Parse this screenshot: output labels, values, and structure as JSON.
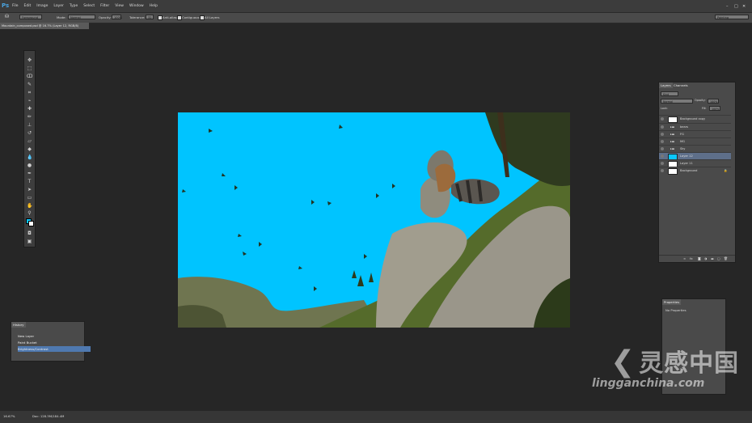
{
  "app": {
    "logo": "Ps"
  },
  "menu": [
    "File",
    "Edit",
    "Image",
    "Layer",
    "Type",
    "Select",
    "Filter",
    "View",
    "Window",
    "Help"
  ],
  "window_controls": [
    "–",
    "□",
    "✕"
  ],
  "options": {
    "sample": "Foreground",
    "mode_label": "Mode:",
    "mode_value": "Normal",
    "opacity_label": "Opacity:",
    "opacity_value": "100%",
    "tolerance_label": "Tolerance:",
    "tolerance_value": "32",
    "anti_alias": "Anti-alias",
    "contiguous": "Contiguous",
    "all_layers": "All Layers",
    "workspace": "Painting"
  },
  "document_tab": "Mountain_composed.psd @ 16.7% (Layer 12, RGB/8)",
  "layers_panel": {
    "tabs": [
      "Layers",
      "Channels"
    ],
    "kind": "Kind",
    "blend": "Normal",
    "opacity_label": "Opacity:",
    "opacity_value": "100%",
    "lock_label": "Lock:",
    "fill_label": "Fill:",
    "fill_value": "100%",
    "layers": [
      {
        "name": "Background copy"
      },
      {
        "name": "bears"
      },
      {
        "name": "FG"
      },
      {
        "name": "MG"
      },
      {
        "name": "Sky"
      },
      {
        "name": "Layer 12"
      },
      {
        "name": "Layer 11"
      },
      {
        "name": "Background"
      }
    ]
  },
  "history_panel": {
    "title": "History",
    "items": [
      "New Layer",
      "Paint Bucket",
      "Brightness/Contrast"
    ]
  },
  "properties_panel": {
    "title": "Properties",
    "empty": "No Properties"
  },
  "status": {
    "zoom": "16.67%",
    "doc": "Doc: 128.3M/184.4M"
  },
  "watermark": {
    "main": "灵感中国",
    "sub": "lingganchina.com"
  },
  "colors": {
    "sky": "#00c4ff",
    "foreground": "#0ac6ff",
    "background": "#ffffff"
  }
}
